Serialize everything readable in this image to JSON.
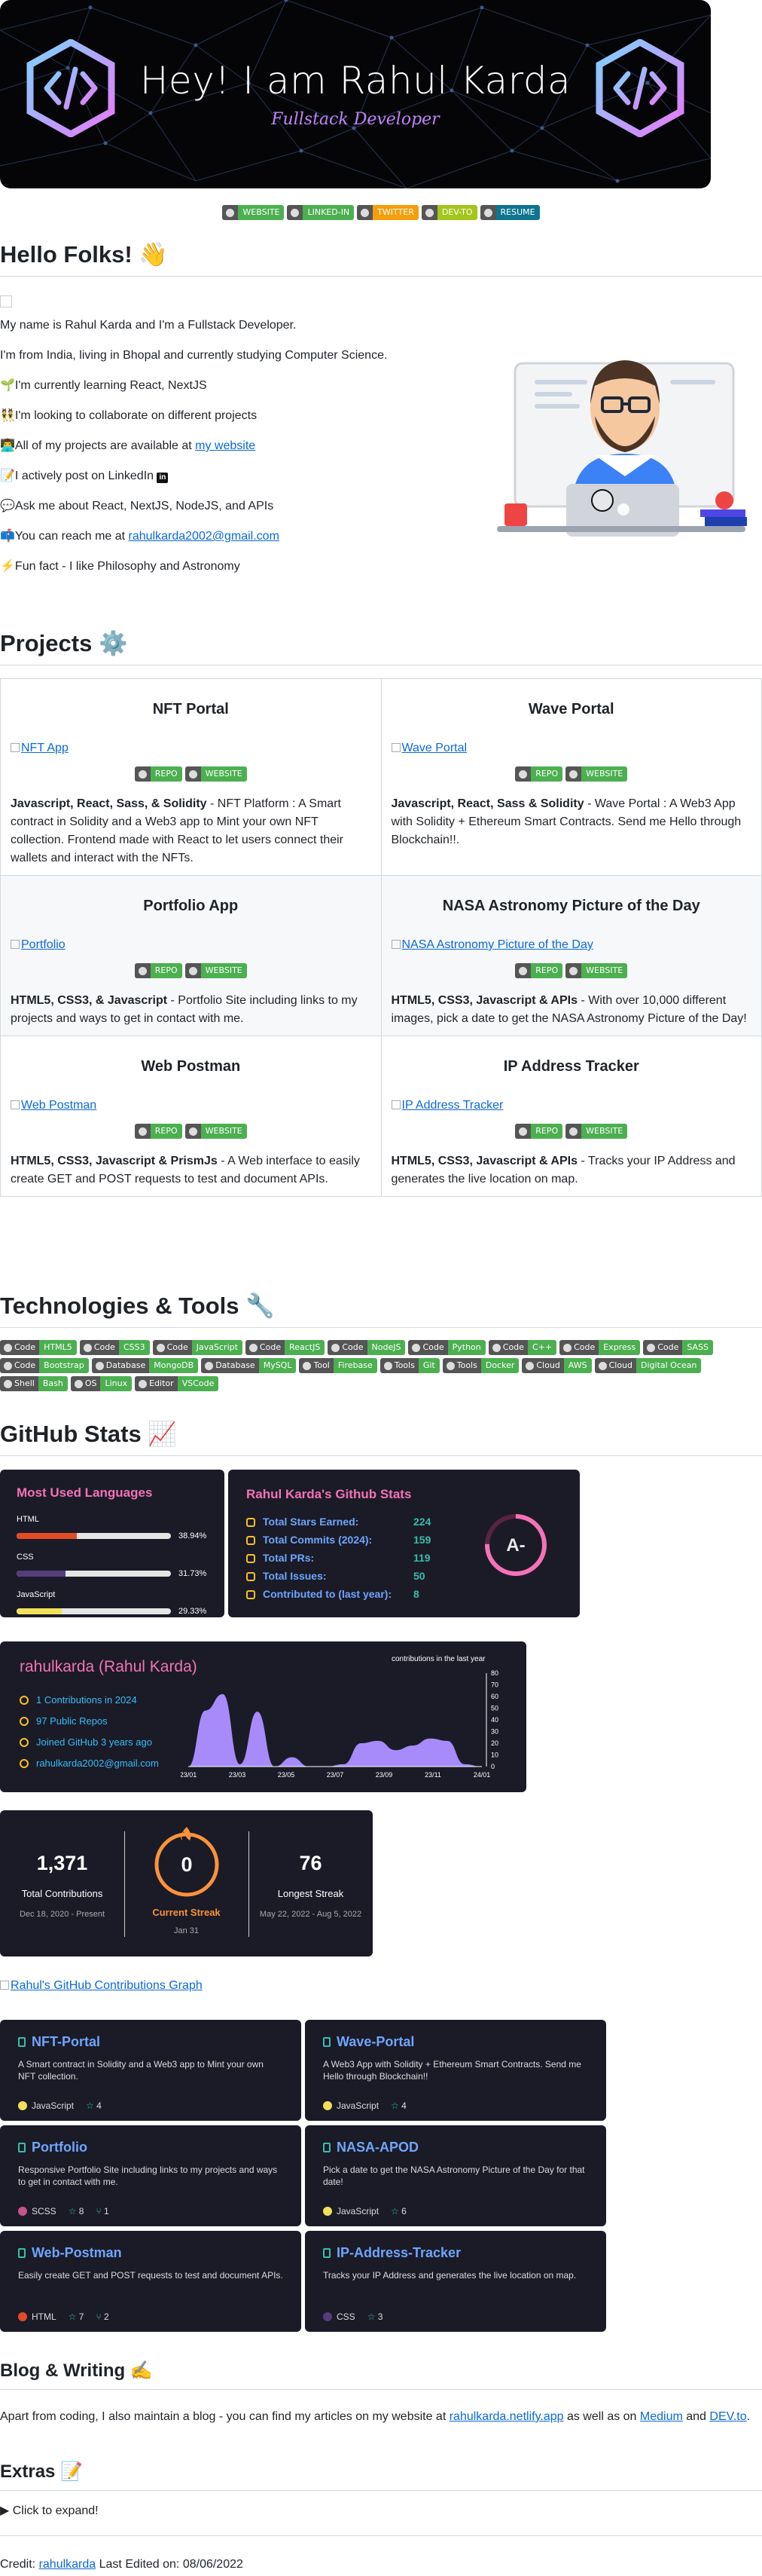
{
  "banner": {
    "title": "Hey! I am Rahul Karda",
    "subtitle": "Fullstack Developer",
    "alt": "Rahul Karda banner"
  },
  "social_badges": [
    {
      "icon": "globe-icon",
      "label": "WEBSITE",
      "color": "#4caf50"
    },
    {
      "icon": "linkedin-icon",
      "label": "LINKED-IN",
      "color": "#4caf50"
    },
    {
      "icon": "twitter-icon",
      "label": "TWITTER",
      "color": "#f59e0b"
    },
    {
      "icon": "devto-icon",
      "label": "DEV-TO",
      "color": "#a3c51c"
    },
    {
      "icon": "resume-icon",
      "label": "RESUME",
      "color": "#0e7490"
    }
  ],
  "hello": {
    "heading": "Hello Folks! 👋",
    "lines": [
      {
        "text": "My name is Rahul Karda and I'm a Fullstack Developer."
      },
      {
        "text": "I'm from India, living in Bhopal and currently studying Computer Science."
      },
      {
        "prefix": "🌱",
        "text": "I'm currently learning React, NextJS"
      },
      {
        "prefix": "👯",
        "text": "I'm looking to collaborate on different projects"
      },
      {
        "prefix": "👨‍💻",
        "text": "All of my projects are available at ",
        "link": "my website"
      },
      {
        "prefix": "📝",
        "text": "I actively post on LinkedIn "
      },
      {
        "prefix": "💬",
        "text": "Ask me about React, NextJS, NodeJS, and APIs"
      },
      {
        "prefix": "📫",
        "text": "You can reach me at ",
        "link": "rahulkarda2002@gmail.com"
      },
      {
        "prefix": "⚡",
        "text": "Fun fact - I like Philosophy and Astronomy"
      }
    ]
  },
  "projects": {
    "heading": "Projects ⚙️",
    "repo_label": "REPO",
    "website_label": "WEBSITE",
    "items": [
      {
        "title": "NFT Portal",
        "img_alt": "NFT App",
        "tech": "Javascript, React, Sass, & Solidity",
        "desc": " - NFT Platform : A Smart contract in Solidity and a Web3 app to Mint your own NFT collection. Frontend made with React to let users connect their wallets and interact with the NFTs."
      },
      {
        "title": "Wave Portal",
        "img_alt": "Wave Portal",
        "tech": "Javascript, React, Sass & Solidity",
        "desc": " - Wave Portal : A Web3 App with Solidity + Ethereum Smart Contracts. Send me Hello through Blockchain!!."
      },
      {
        "title": "Portfolio App",
        "img_alt": "Portfolio",
        "tech": "HTML5, CSS3, & Javascript",
        "desc": " - Portfolio Site including links to my projects and ways to get in contact with me."
      },
      {
        "title": "NASA Astronomy Picture of the Day",
        "img_alt": "NASA Astronomy Picture of the Day",
        "tech": "HTML5, CSS3, Javascript & APIs",
        "desc": " - With over 10,000 different images, pick a date to get the NASA Astronomy Picture of the Day!"
      },
      {
        "title": "Web Postman",
        "img_alt": "Web Postman",
        "tech": "HTML5, CSS3, Javascript & PrismJs",
        "desc": " - A Web interface to easily create GET and POST requests to test and document APIs."
      },
      {
        "title": "IP Address Tracker",
        "img_alt": "IP Address Tracker",
        "tech": "HTML5, CSS3, Javascript & APIs",
        "desc": " - Tracks your IP Address and generates the live location on map."
      }
    ]
  },
  "tech": {
    "heading": "Technologies & Tools 🔧",
    "badges": [
      {
        "l": "Code",
        "r": "HTML5",
        "c": "#4caf50"
      },
      {
        "l": "Code",
        "r": "CSS3",
        "c": "#4caf50"
      },
      {
        "l": "Code",
        "r": "JavaScript",
        "c": "#4caf50"
      },
      {
        "l": "Code",
        "r": "ReactJS",
        "c": "#4caf50"
      },
      {
        "l": "Code",
        "r": "NodeJS",
        "c": "#4caf50"
      },
      {
        "l": "Code",
        "r": "Python",
        "c": "#4caf50"
      },
      {
        "l": "Code",
        "r": "C++",
        "c": "#4caf50"
      },
      {
        "l": "Code",
        "r": "Express",
        "c": "#4caf50"
      },
      {
        "l": "Code",
        "r": "SASS",
        "c": "#4caf50"
      },
      {
        "l": "Code",
        "r": "Bootstrap",
        "c": "#4caf50"
      },
      {
        "l": "Database",
        "r": "MongoDB",
        "c": "#4caf50"
      },
      {
        "l": "Database",
        "r": "MySQL",
        "c": "#4caf50"
      },
      {
        "l": "Tool",
        "r": "Firebase",
        "c": "#4caf50"
      },
      {
        "l": "Tools",
        "r": "Git",
        "c": "#4caf50"
      },
      {
        "l": "Tools",
        "r": "Docker",
        "c": "#4caf50"
      },
      {
        "l": "Cloud",
        "r": "AWS",
        "c": "#4caf50"
      },
      {
        "l": "Cloud",
        "r": "Digital Ocean",
        "c": "#4caf50"
      },
      {
        "l": "Shell",
        "r": "Bash",
        "c": "#4caf50"
      },
      {
        "l": "OS",
        "r": "Linux",
        "c": "#4caf50"
      },
      {
        "l": "Editor",
        "r": "VSCode",
        "c": "#4caf50"
      }
    ]
  },
  "github": {
    "heading": "GitHub Stats 📈",
    "languages": {
      "title": "Most Used Languages",
      "items": [
        {
          "name": "HTML",
          "pct": 38.94,
          "label": "38.94%",
          "color": "#e34c26"
        },
        {
          "name": "CSS",
          "pct": 31.73,
          "label": "31.73%",
          "color": "#563d7c"
        },
        {
          "name": "JavaScript",
          "pct": 29.33,
          "label": "29.33%",
          "color": "#f1e05a"
        }
      ]
    },
    "stats": {
      "title": "Rahul Karda's Github Stats",
      "rows": [
        {
          "icon": "star-icon",
          "label": "Total Stars Earned:",
          "value": "224"
        },
        {
          "icon": "clock-icon",
          "label": "Total Commits (2024):",
          "value": "159"
        },
        {
          "icon": "pull-request-icon",
          "label": "Total PRs:",
          "value": "119"
        },
        {
          "icon": "issue-icon",
          "label": "Total Issues:",
          "value": "50"
        },
        {
          "icon": "repo-icon",
          "label": "Contributed to (last year):",
          "value": "8"
        }
      ],
      "grade": "A-"
    },
    "profile": {
      "title": "rahulkarda (Rahul Karda)",
      "rows": [
        {
          "icon": "commit-icon",
          "text": "1 Contributions in 2024"
        },
        {
          "icon": "repo-icon",
          "text": "97 Public Repos"
        },
        {
          "icon": "clock-icon",
          "text": "Joined GitHub 3 years ago"
        },
        {
          "icon": "mail-icon",
          "text": "rahulkarda2002@gmail.com"
        }
      ],
      "chart_caption": "contributions in the last year",
      "chart_data": {
        "type": "area",
        "x": [
          "23/01",
          "23/03",
          "23/05",
          "23/07",
          "23/09",
          "23/11",
          "24/01"
        ],
        "ylim": [
          0,
          80
        ],
        "yticks": [
          0,
          10,
          20,
          30,
          40,
          50,
          60,
          70,
          80
        ],
        "values": [
          0,
          48,
          62,
          2,
          47,
          0,
          8,
          0,
          0,
          2,
          20,
          22,
          14,
          18,
          24,
          22,
          2,
          0
        ],
        "color": "#a78bfa"
      }
    },
    "streak": {
      "total": "1,371",
      "total_label": "Total Contributions",
      "total_range": "Dec 18, 2020 - Present",
      "current": "0",
      "current_label": "Current Streak",
      "current_date": "Jan 31",
      "longest": "76",
      "longest_label": "Longest Streak",
      "longest_range": "May 22, 2022 - Aug 5, 2022"
    },
    "graph_link": "Rahul's GitHub Contributions Graph",
    "pins": [
      {
        "name": "NFT-Portal",
        "desc": "A Smart contract in Solidity and a Web3 app to Mint your own NFT collection.",
        "lang": "JavaScript",
        "lang_color": "#f1e05a",
        "stars": "4",
        "forks": ""
      },
      {
        "name": "Wave-Portal",
        "desc": "A Web3 App with Solidity + Ethereum Smart Contracts. Send me Hello through Blockchain!!",
        "lang": "JavaScript",
        "lang_color": "#f1e05a",
        "stars": "4",
        "forks": ""
      },
      {
        "name": "Portfolio",
        "desc": "Responsive Portfolio Site including links to my projects and ways to get in contact with me.",
        "lang": "SCSS",
        "lang_color": "#c6538c",
        "stars": "8",
        "forks": "1"
      },
      {
        "name": "NASA-APOD",
        "desc": "Pick a date to get the NASA Astronomy Picture of the Day for that date!",
        "lang": "JavaScript",
        "lang_color": "#f1e05a",
        "stars": "6",
        "forks": ""
      },
      {
        "name": "Web-Postman",
        "desc": "Easily create GET and POST requests to test and document APIs.",
        "lang": "HTML",
        "lang_color": "#e34c26",
        "stars": "7",
        "forks": "2"
      },
      {
        "name": "IP-Address-Tracker",
        "desc": "Tracks your IP Address and generates the live location on map.",
        "lang": "CSS",
        "lang_color": "#563d7c",
        "stars": "3",
        "forks": ""
      }
    ]
  },
  "blog": {
    "heading": "Blog & Writing ✍️",
    "text1": "Apart from coding, I also maintain a blog - you can find my articles on my website at ",
    "link1": "rahulkarda.netlify.app",
    "text2": " as well as on ",
    "link2": "Medium",
    "text3": " and ",
    "link3": "DEV.to",
    "text4": "."
  },
  "extras": {
    "heading": "Extras 📝",
    "summary": "Click to expand!"
  },
  "footer": {
    "prefix": "Credit: ",
    "link": "rahulkarda",
    "suffix": " Last Edited on: 08/06/2022"
  }
}
